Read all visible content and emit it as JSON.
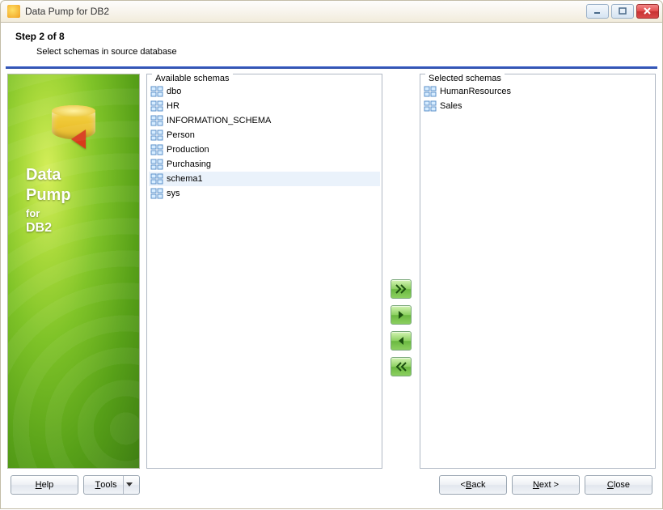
{
  "window": {
    "title": "Data Pump for DB2"
  },
  "step": {
    "title": "Step 2 of 8",
    "subtitle": "Select schemas in source database"
  },
  "brand": {
    "line1": "Data",
    "line2": "Pump",
    "line3": "for",
    "line4": "DB2"
  },
  "lists": {
    "available_label": "Available schemas",
    "selected_label": "Selected schemas",
    "available": [
      "dbo",
      "HR",
      "INFORMATION_SCHEMA",
      "Person",
      "Production",
      "Purchasing",
      "schema1",
      "sys"
    ],
    "available_selected_index": 6,
    "selected": [
      "HumanResources",
      "Sales"
    ]
  },
  "transfer": {
    "add_all": "add-all",
    "add_one": "add-one",
    "remove_one": "remove-one",
    "remove_all": "remove-all"
  },
  "footer": {
    "help_pre": "",
    "help_m": "H",
    "help_post": "elp",
    "tools_pre": "",
    "tools_m": "T",
    "tools_post": "ools",
    "back_pre": "< ",
    "back_m": "B",
    "back_post": "ack",
    "next_pre": "",
    "next_m": "N",
    "next_post": "ext >",
    "close_pre": "",
    "close_m": "C",
    "close_post": "lose"
  }
}
